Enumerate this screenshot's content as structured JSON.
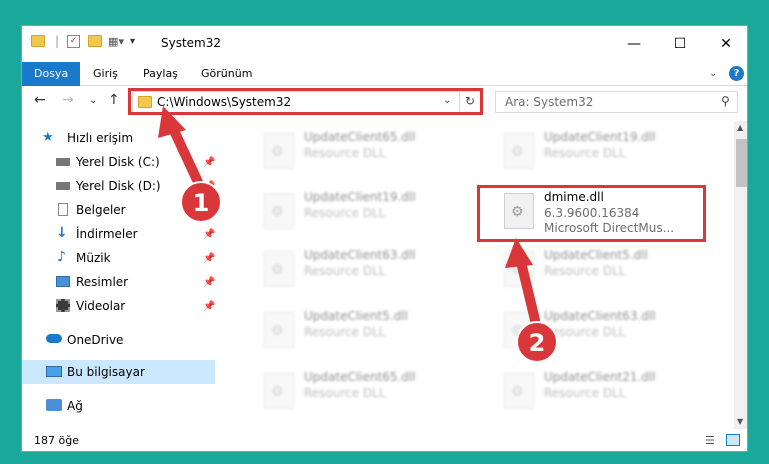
{
  "window": {
    "title": "System32"
  },
  "ribbon": {
    "tabs": [
      {
        "label": "Dosya"
      },
      {
        "label": "Giriş"
      },
      {
        "label": "Paylaş"
      },
      {
        "label": "Görünüm"
      }
    ]
  },
  "address": {
    "path": "C:\\Windows\\System32"
  },
  "search": {
    "placeholder": "Ara: System32"
  },
  "sidebar": {
    "items": [
      {
        "label": "Hızlı erişim",
        "icon": "star-icon"
      },
      {
        "label": "Yerel Disk (C:)",
        "icon": "drive-icon"
      },
      {
        "label": "Yerel Disk (D:)",
        "icon": "drive-icon"
      },
      {
        "label": "Belgeler",
        "icon": "documents-icon"
      },
      {
        "label": "İndirmeler",
        "icon": "download-icon"
      },
      {
        "label": "Müzik",
        "icon": "music-icon"
      },
      {
        "label": "Resimler",
        "icon": "pictures-icon"
      },
      {
        "label": "Videolar",
        "icon": "videos-icon"
      },
      {
        "label": "OneDrive",
        "icon": "cloud-icon"
      },
      {
        "label": "Bu bilgisayar",
        "icon": "computer-icon"
      },
      {
        "label": "Ağ",
        "icon": "network-icon"
      }
    ]
  },
  "files": {
    "highlighted": {
      "name": "dmime.dll",
      "version": "6.3.9600.16384",
      "description": "Microsoft DirectMus..."
    },
    "left": [
      {
        "name": "UpdateClient65.dll",
        "desc": "Resource DLL"
      },
      {
        "name": "UpdateClient19.dll",
        "desc": "Resource DLL"
      },
      {
        "name": "UpdateClient63.dll",
        "desc": "Resource DLL"
      },
      {
        "name": "UpdateClient5.dll",
        "desc": "Resource DLL"
      },
      {
        "name": "UpdateClient65.dll",
        "desc": "Resource DLL"
      }
    ],
    "right": [
      {
        "name": "UpdateClient19.dll",
        "desc": "Resource DLL"
      },
      {
        "name": "UpdateClient5.dll",
        "desc": "Resource DLL"
      },
      {
        "name": "UpdateClient63.dll",
        "desc": "Resource DLL"
      },
      {
        "name": "UpdateClient21.dll",
        "desc": "Resource DLL"
      }
    ]
  },
  "status": {
    "count": "187 öğe"
  },
  "annotations": {
    "badge1": "1",
    "badge2": "2",
    "color": "#d9373a"
  }
}
